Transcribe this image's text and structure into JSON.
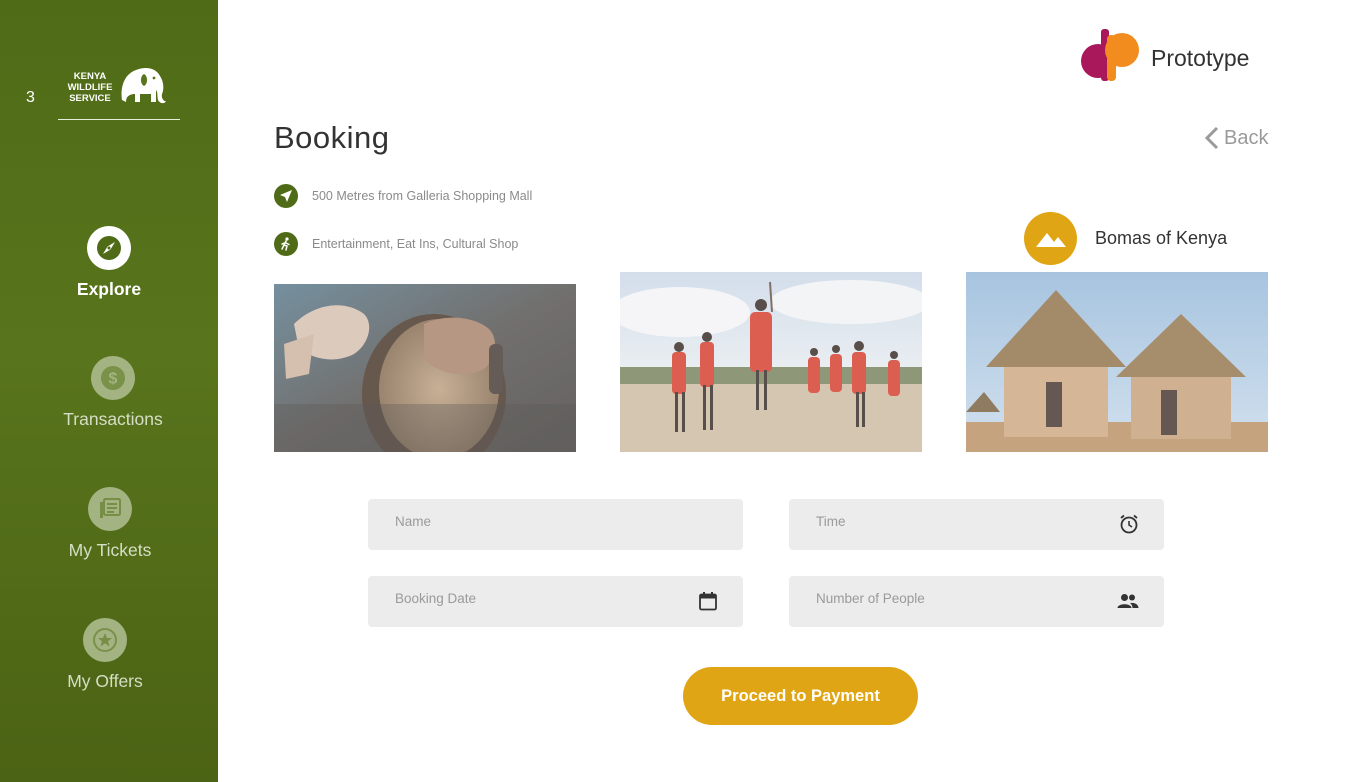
{
  "sidebar": {
    "badge_number": "3",
    "logo_lines": [
      "KENYA",
      "WILDLIFE",
      "SERVICE"
    ],
    "nav": [
      {
        "label": "Explore",
        "icon": "compass-icon",
        "active": true
      },
      {
        "label": "Transactions",
        "icon": "dollar-icon",
        "active": false
      },
      {
        "label": "My Tickets",
        "icon": "ticket-icon",
        "active": false
      },
      {
        "label": "My Offers",
        "icon": "star-icon",
        "active": false
      }
    ]
  },
  "header": {
    "brand": "Prototype",
    "title": "Booking",
    "back_label": "Back"
  },
  "info": {
    "location": "500 Metres from Galleria Shopping Mall",
    "amenities": "Entertainment, Eat Ins, Cultural Shop"
  },
  "place": {
    "name": "Bomas of Kenya",
    "icon": "mountain-icon"
  },
  "photos": [
    {
      "subject": "drummer-photo"
    },
    {
      "subject": "maasai-dancers-photo"
    },
    {
      "subject": "thatched-huts-photo"
    }
  ],
  "form": {
    "name_placeholder": "Name",
    "time_placeholder": "Time",
    "date_placeholder": "Booking Date",
    "people_placeholder": "Number of People"
  },
  "cta_label": "Proceed to Payment",
  "colors": {
    "sidebar": "#4f6b17",
    "accent": "#e0a514",
    "field": "#ececec"
  }
}
